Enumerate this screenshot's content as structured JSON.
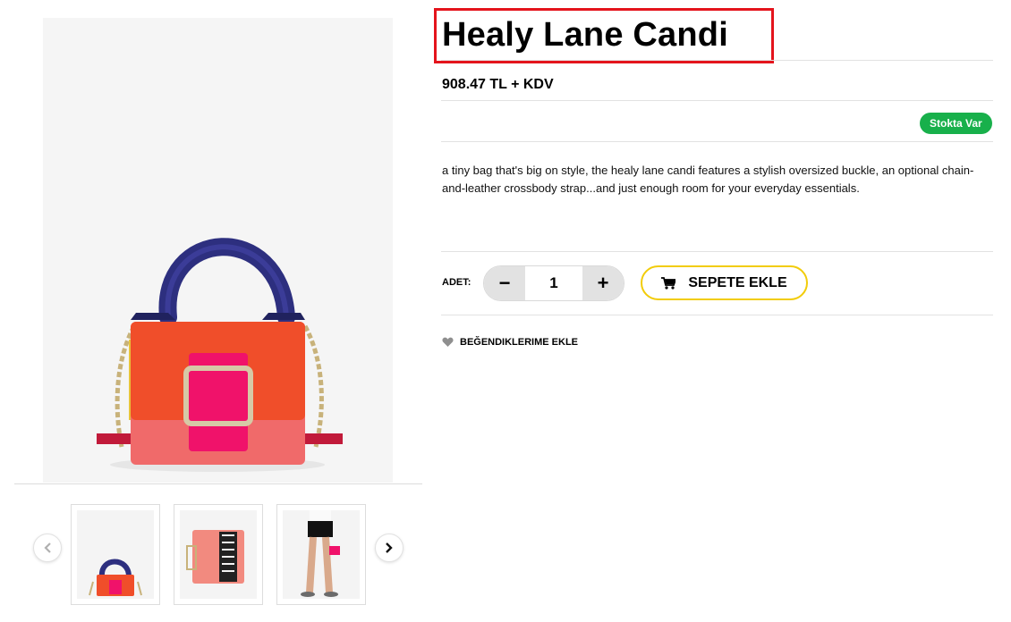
{
  "gallery": {
    "prev_icon": "chevron-left-icon",
    "next_icon": "chevron-right-icon",
    "thumbnails": [
      "bag-front",
      "bag-open",
      "model-holding-bag"
    ]
  },
  "product": {
    "title": "Healy Lane Candi",
    "price": "908.47 TL + KDV",
    "stock_status": "Stokta Var",
    "description": "a tiny bag that's big on style, the healy lane candi features a stylish oversized buckle, an optional chain-and-leather crossbody strap...and just enough room for your everyday essentials."
  },
  "purchase": {
    "qty_label": "ADET:",
    "qty_minus": "−",
    "qty_value": "1",
    "qty_plus": "+",
    "cart_label": "SEPETE EKLE",
    "cart_icon": "cart-icon"
  },
  "wishlist": {
    "label": "BEĞENDIKLERIME EKLE",
    "icon": "heart-icon"
  },
  "colors": {
    "highlight": "#e4141c",
    "stock_badge": "#18b04b",
    "cart_border": "#f2cc0a"
  }
}
